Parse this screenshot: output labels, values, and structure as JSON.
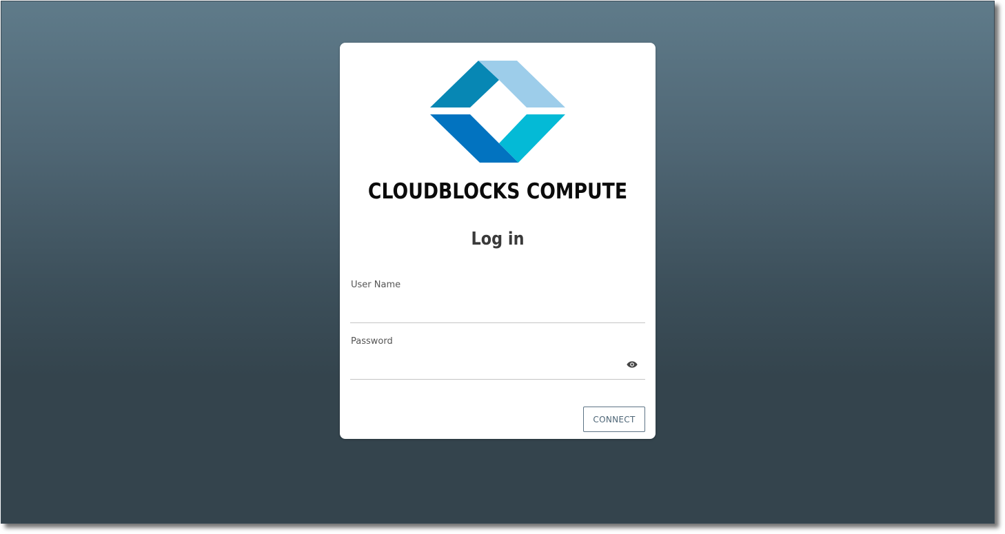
{
  "brand": {
    "name": "CLOUDBLOCKS COMPUTE",
    "logo_icon": "cloudblocks-logo-icon",
    "logo_colors": [
      "#0787b4",
      "#9dcdea",
      "#0273c0",
      "#04bad6"
    ]
  },
  "login": {
    "title": "Log in",
    "username_label": "User Name",
    "username_value": "",
    "password_label": "Password",
    "password_value": "",
    "show_password_icon": "eye-icon",
    "connect_label": "CONNECT"
  },
  "colors": {
    "background_top": "#5f7b8a",
    "background_bottom": "#34444d",
    "button_border": "#5c7385"
  }
}
